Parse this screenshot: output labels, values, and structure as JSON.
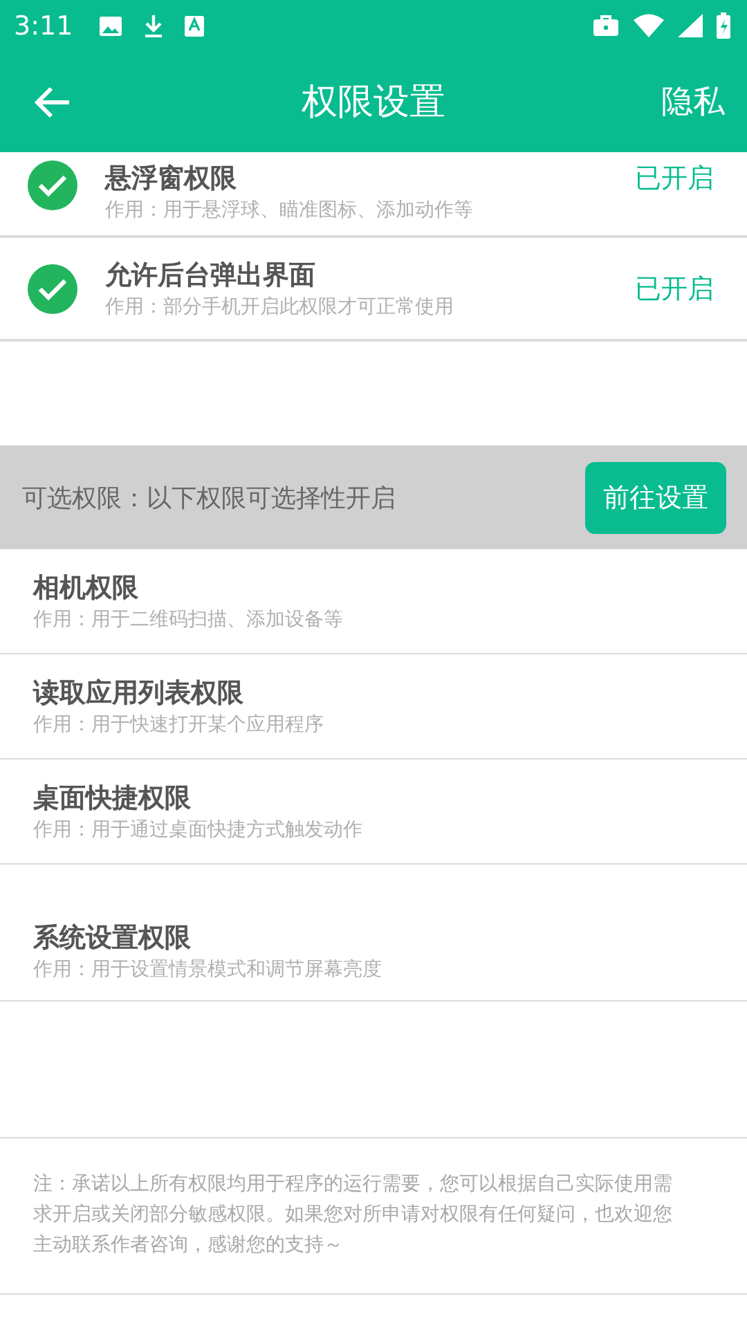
{
  "status_bar": {
    "time": "3:11"
  },
  "app_bar": {
    "title": "权限设置",
    "action": "隐私"
  },
  "required_permissions": [
    {
      "name": "悬浮窗权限",
      "description": "作用：用于悬浮球、瞄准图标、添加动作等",
      "granted": true,
      "status": "已开启"
    },
    {
      "name": "允许后台弹出界面",
      "description": "作用：部分手机开启此权限才可正常使用",
      "granted": true,
      "status": "已开启"
    }
  ],
  "optional_section": {
    "label": "可选权限：以下权限可选择性开启",
    "button": "前往设置"
  },
  "optional_permissions": [
    {
      "name": "相机权限",
      "description": "作用：用于二维码扫描、添加设备等"
    },
    {
      "name": "读取应用列表权限",
      "description": "作用：用于快速打开某个应用程序"
    },
    {
      "name": "桌面快捷权限",
      "description": "作用：用于通过桌面快捷方式触发动作"
    },
    {
      "name": "系统设置权限",
      "description": "作用：用于设置情景模式和调节屏幕亮度"
    }
  ],
  "note": "注：承诺以上所有权限均用于程序的运行需要，您可以根据自己实际使用需求开启或关闭部分敏感权限。如果您对所申请对权限有任何疑问，也欢迎您主动联系作者咨询，感谢您的支持～"
}
